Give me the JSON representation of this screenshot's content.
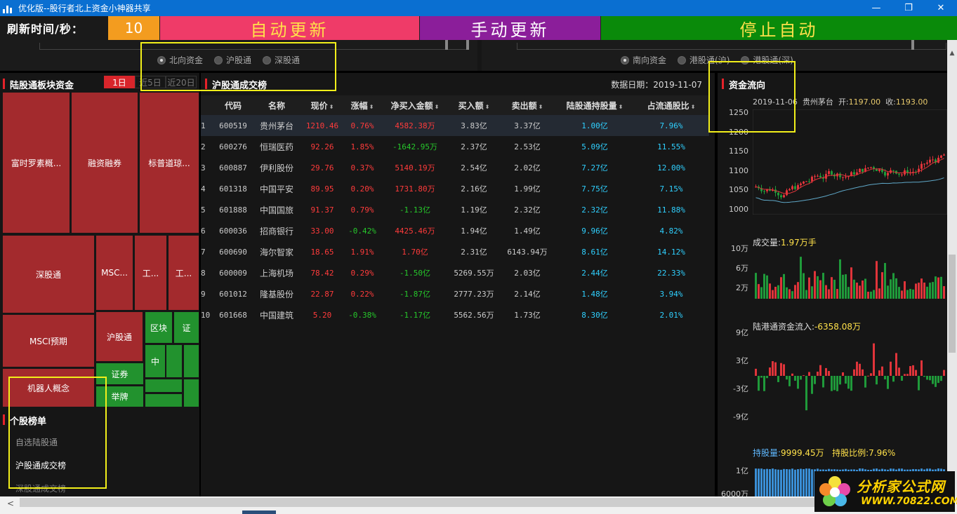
{
  "window": {
    "title": "优化版--股行者北上资金小神器共享",
    "minimize": "—",
    "maximize": "❐",
    "close": "✕"
  },
  "toolbar": {
    "refresh_label": "刷新时间/秒：",
    "refresh_value": "10",
    "auto_update": "自动更新",
    "manual_update": "手动更新",
    "stop_auto": "停止自动"
  },
  "left_radios": [
    "北向资金",
    "沪股通",
    "深股通"
  ],
  "right_radios": [
    "南向资金",
    "港股通(沪)",
    "港股通(深)"
  ],
  "sector_panel": {
    "title": "陆股通板块资金",
    "periods": [
      "1日",
      "近5日",
      "近20日"
    ],
    "tiles": [
      {
        "label": "富时罗素概...",
        "color": "red"
      },
      {
        "label": "融资融券",
        "color": "red"
      },
      {
        "label": "标普道琼...",
        "color": "red"
      },
      {
        "label": "深股通",
        "color": "red"
      },
      {
        "label": "MSC...",
        "color": "red"
      },
      {
        "label": "工...",
        "color": "red"
      },
      {
        "label": "工...",
        "color": "red"
      },
      {
        "label": "MSCI预期",
        "color": "red"
      },
      {
        "label": "沪股通",
        "color": "red"
      },
      {
        "label": "区块",
        "color": "green"
      },
      {
        "label": "证",
        "color": "green"
      },
      {
        "label": "中",
        "color": "green"
      },
      {
        "label": "机器人概念",
        "color": "red"
      },
      {
        "label": "证券",
        "color": "green"
      },
      {
        "label": "举牌",
        "color": "green"
      }
    ]
  },
  "stock_list": {
    "title": "个股榜单",
    "items": [
      "自选陆股通",
      "沪股通成交榜",
      "深股通成交榜"
    ]
  },
  "table": {
    "title": "沪股通成交榜",
    "date_label": "数据日期：2019-11-07",
    "columns": [
      "代码",
      "名称",
      "现价",
      "涨幅",
      "净买入金额",
      "买入额",
      "卖出额",
      "陆股通持股量",
      "占流通股比"
    ],
    "rows": [
      [
        "1",
        "600519",
        "贵州茅台",
        "1210.46",
        "0.76%",
        "4582.38万",
        "3.83亿",
        "3.37亿",
        "1.00亿",
        "7.96%"
      ],
      [
        "2",
        "600276",
        "恒瑞医药",
        "92.26",
        "1.85%",
        "-1642.95万",
        "2.37亿",
        "2.53亿",
        "5.09亿",
        "11.55%"
      ],
      [
        "3",
        "600887",
        "伊利股份",
        "29.76",
        "0.37%",
        "5140.19万",
        "2.54亿",
        "2.02亿",
        "7.27亿",
        "12.00%"
      ],
      [
        "4",
        "601318",
        "中国平安",
        "89.95",
        "0.20%",
        "1731.80万",
        "2.16亿",
        "1.99亿",
        "7.75亿",
        "7.15%"
      ],
      [
        "5",
        "601888",
        "中国国旅",
        "91.37",
        "0.79%",
        "-1.13亿",
        "1.19亿",
        "2.32亿",
        "2.32亿",
        "11.88%"
      ],
      [
        "6",
        "600036",
        "招商银行",
        "33.00",
        "-0.42%",
        "4425.46万",
        "1.94亿",
        "1.49亿",
        "9.96亿",
        "4.82%"
      ],
      [
        "7",
        "600690",
        "海尔智家",
        "18.65",
        "1.91%",
        "1.70亿",
        "2.31亿",
        "6143.94万",
        "8.61亿",
        "14.12%"
      ],
      [
        "8",
        "600009",
        "上海机场",
        "78.42",
        "0.29%",
        "-1.50亿",
        "5269.55万",
        "2.03亿",
        "2.44亿",
        "22.33%"
      ],
      [
        "9",
        "601012",
        "隆基股份",
        "22.87",
        "0.22%",
        "-1.87亿",
        "2777.23万",
        "2.14亿",
        "1.48亿",
        "3.94%"
      ],
      [
        "10",
        "601668",
        "中国建筑",
        "5.20",
        "-0.38%",
        "-1.17亿",
        "5562.56万",
        "1.73亿",
        "8.30亿",
        "2.01%"
      ]
    ]
  },
  "fund_flow": {
    "title": "资金流向",
    "info_date": "2019-11-06",
    "info_name": "贵州茅台",
    "open_label": "开:",
    "open_value": "1197.00",
    "close_label": "收:",
    "close_value": "1193.00",
    "price_ticks": [
      "1250",
      "1200",
      "1150",
      "1100",
      "1050",
      "1000"
    ],
    "volume_label": "成交量:",
    "volume_value": "1.97万手",
    "volume_ticks": [
      "10万",
      "6万",
      "2万"
    ],
    "inflow_label": "陆港通资金流入:",
    "inflow_value": "-6358.08万",
    "inflow_ticks": [
      "9亿",
      "3亿",
      "-3亿",
      "-9亿"
    ],
    "holding_label": "持股量:",
    "holding_value": "9999.45万",
    "ratio_label": "持股比例:",
    "ratio_value": "7.96%",
    "holding_ticks": [
      "1亿",
      "6000万"
    ],
    "colors": {
      "up": "#e0343a",
      "down": "#1f9a3a",
      "ma1": "#e0343a",
      "ma2": "#5fa8c8",
      "holding": "#3a8fd6"
    }
  },
  "watermark": {
    "cn": "分析家公式网",
    "url": "WWW.70822.COM"
  }
}
